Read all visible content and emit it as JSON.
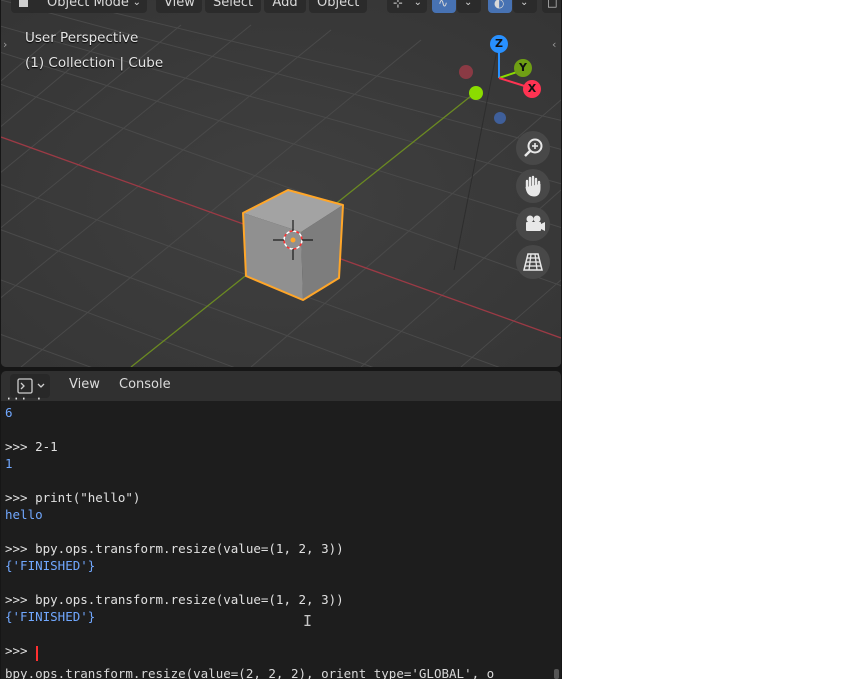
{
  "header": {
    "mode_label": "Object Mode",
    "menus": [
      "View",
      "Select",
      "Add",
      "Object"
    ]
  },
  "viewport": {
    "perspective_label": "User Perspective",
    "collection_label": "(1) Collection | Cube",
    "gizmo": {
      "x_label": "X",
      "y_label": "Y",
      "z_label": "Z"
    },
    "nav_icons": [
      "zoom-icon",
      "pan-hand-icon",
      "camera-icon",
      "grid-perspective-icon"
    ],
    "colors": {
      "x_axis": "#ff3352",
      "y_axis": "#8bdc00",
      "z_axis": "#2890ff",
      "selection": "#ffa629"
    }
  },
  "console": {
    "menus": {
      "view": "View",
      "console": "Console"
    },
    "lines": [
      {
        "type": "output",
        "text": "6"
      },
      {
        "type": "input",
        "text": ">>> 2-1"
      },
      {
        "type": "output",
        "text": "1"
      },
      {
        "type": "input",
        "text": ">>> print(\"hello\")"
      },
      {
        "type": "output",
        "text": "hello"
      },
      {
        "type": "input",
        "text": ">>> bpy.ops.transform.resize(value=(1, 2, 3))"
      },
      {
        "type": "output",
        "text": "{'FINISHED'}"
      },
      {
        "type": "input",
        "text": ">>> bpy.ops.transform.resize(value=(1, 2, 3))"
      },
      {
        "type": "output",
        "text": "{'FINISHED'}"
      },
      {
        "type": "input",
        "text": ">>> "
      },
      {
        "type": "info",
        "text": "bpy.ops.transform.resize(value=(2, 2, 2), orient_type='GLOBAL', o"
      }
    ]
  }
}
